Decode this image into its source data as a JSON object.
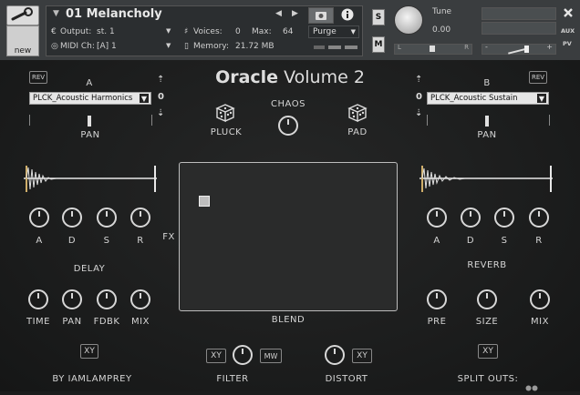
{
  "header": {
    "tool_icon": "wrench-icon",
    "new_label": "new",
    "instrument_name": "01 Melancholy",
    "output_label": "Output:",
    "output_value": "st. 1",
    "midi_label": "MIDI Ch:",
    "midi_value": "[A] 1",
    "voices_label": "Voices:",
    "voices_value": "0",
    "max_label": "Max:",
    "max_value": "64",
    "memory_label": "Memory:",
    "memory_value": "21.72 MB",
    "purge_label": "Purge",
    "s_label": "S",
    "m_label": "M",
    "tune_label": "Tune",
    "tune_value": "0.00",
    "pan_left": "L",
    "pan_right": "R",
    "aux_label": "AUX",
    "pv_label": "PV",
    "vol_minus": "-",
    "vol_plus": "+"
  },
  "title": {
    "part1": "Oracle",
    "part2": "Volume 2"
  },
  "left": {
    "rev_label": "REV",
    "slot_label": "A",
    "preset": "PLCK_Acoustic Harmonics",
    "transpose": "0",
    "pan_label": "PAN",
    "adsr": [
      "A",
      "D",
      "S",
      "R"
    ],
    "section_label": "DELAY",
    "fx_knobs": [
      "TIME",
      "PAN",
      "FDBK",
      "MIX"
    ],
    "xy_label": "XY"
  },
  "right": {
    "rev_label": "REV",
    "slot_label": "B",
    "preset": "PLCK_Acoustic Sustain",
    "transpose": "0",
    "pan_label": "PAN",
    "adsr": [
      "A",
      "D",
      "S",
      "R"
    ],
    "section_label": "REVERB",
    "fx_knobs": [
      "PRE",
      "SIZE",
      "MIX"
    ],
    "xy_label": "XY"
  },
  "center": {
    "chaos_label": "CHAOS",
    "pluck_label": "PLUCK",
    "pad_label": "PAD",
    "fx_label": "FX",
    "blend_label": "BLEND",
    "filter_label": "FILTER",
    "distort_label": "DISTORT",
    "xy_label": "XY",
    "mw_label": "MW"
  },
  "footer": {
    "credit": "BY IAMLAMPREY",
    "split_outs": "SPLIT OUTS:"
  }
}
